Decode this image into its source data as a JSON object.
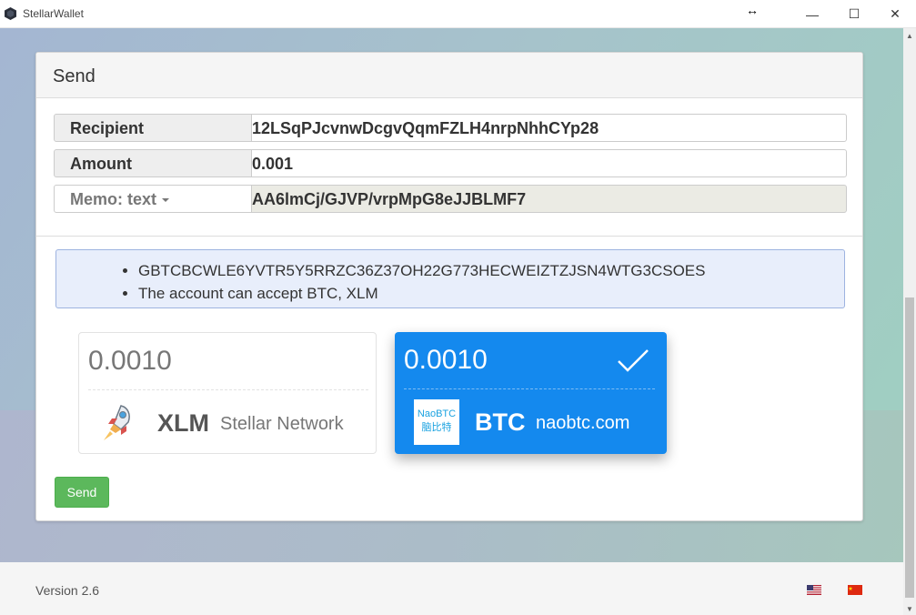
{
  "window": {
    "title": "StellarWallet",
    "minimize_symbol": "—",
    "maximize_symbol": "☐",
    "close_symbol": "✕",
    "cursor_symbol": "↔"
  },
  "send_panel": {
    "title": "Send",
    "recipient_label": "Recipient",
    "recipient_value": "12LSqPJcvnwDcgvQqmFZLH4nrpNhhCYp28",
    "amount_label": "Amount",
    "amount_value": "0.001",
    "memo_label": "Memo: text",
    "memo_value": "AA6lmCj/GJVP/vrpMpG8eJJBLMF7",
    "info_items": [
      "GBTCBCWLE6YVTR5Y5RRZC36Z37OH22G773HECWEIZTZJSN4WTG3CSOES",
      "The account can accept BTC, XLM"
    ],
    "assets": [
      {
        "amount": "0.0010",
        "code": "XLM",
        "issuer": "Stellar Network",
        "icon": "rocket-icon",
        "selected": false
      },
      {
        "amount": "0.0010",
        "code": "BTC",
        "issuer": "naobtc.com",
        "icon": "naobtc-logo",
        "logo_line1": "NaoBTC",
        "logo_line2": "脑比特",
        "selected": true
      }
    ],
    "send_button": "Send"
  },
  "footer": {
    "version": "Version 2.6",
    "flags": [
      "us-flag-icon",
      "cn-flag-icon"
    ]
  },
  "colors": {
    "accent": "#1489ee",
    "send_button": "#5cb85c",
    "info_bg": "#e8eefb"
  }
}
